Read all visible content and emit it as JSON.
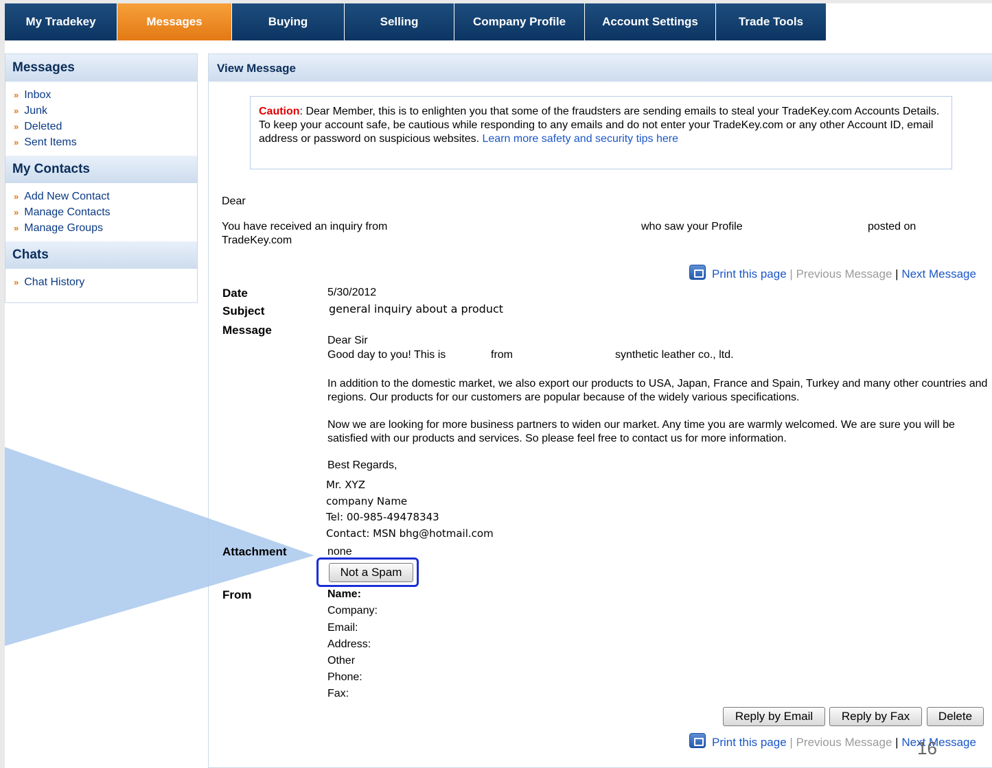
{
  "nav": {
    "tabs": [
      {
        "label": "My Tradekey",
        "active": false
      },
      {
        "label": "Messages",
        "active": true
      },
      {
        "label": "Buying",
        "active": false
      },
      {
        "label": "Selling",
        "active": false
      },
      {
        "label": "Company Profile",
        "active": false
      },
      {
        "label": "Account Settings",
        "active": false
      },
      {
        "label": "Trade Tools",
        "active": false
      }
    ]
  },
  "sidebar": {
    "messages_title": "Messages",
    "messages_items": [
      "Inbox",
      "Junk",
      "Deleted",
      "Sent Items"
    ],
    "contacts_title": "My Contacts",
    "contacts_items": [
      "Add New Contact",
      "Manage Contacts",
      "Manage Groups"
    ],
    "chats_title": "Chats",
    "chats_items": [
      "Chat History"
    ],
    "bullet": "»"
  },
  "main": {
    "title": "View Message",
    "caution": {
      "word": "Caution",
      "text": ": Dear Member, this is to enlighten you that some of the fraudsters are sending emails to steal your TradeKey.com Accounts Details. To keep your account safe, be cautious while responding to any emails and do not enter your TradeKey.com or any other Account ID, email address or password on suspicious websites. ",
      "link": "Learn more safety and security tips here"
    },
    "greeting": "Dear",
    "inquiry_text": "You have received an inquiry from",
    "saw_profile_text": "who saw your Profile",
    "posted_on_text": "posted on",
    "site_name": "TradeKey.com",
    "nav_links": {
      "print": "Print this page",
      "separator": "|",
      "previous": "Previous Message",
      "next": "Next Message"
    },
    "fields": {
      "date_label": "Date",
      "date_value": "5/30/2012",
      "subject_label": "Subject",
      "subject_value": "general inquiry about a product",
      "message_label": "Message",
      "attachment_label": "Attachment",
      "attachment_value": "none",
      "from_label": "From"
    },
    "message": {
      "salutation": "Dear Sir",
      "line1_a": "Good day to you! This is",
      "line1_b": "from",
      "line1_c": "synthetic leather co., ltd.",
      "para1": "In addition to the domestic market, we also export our products to USA, Japan, France and Spain, Turkey and many other countries and regions. Our products for our customers are popular because of the widely various specifications.",
      "para2": "Now we are looking for more business partners to widen our market. Any time you are warmly welcomed. We are sure you will be satisfied with our products and services. So please feel free to contact us for more information.",
      "closing": "Best Regards,",
      "sig_name": "Mr. XYZ",
      "sig_company": "company Name",
      "sig_tel": "Tel: 00-985-49478343",
      "sig_contact": "Contact: MSN bhg@hotmail.com"
    },
    "not_spam_button": "Not a Spam",
    "from_details": {
      "name": "Name:",
      "company": "Company:",
      "email": "Email:",
      "address": "Address:",
      "other": "Other",
      "phone": "Phone:",
      "fax": "Fax:"
    },
    "buttons": {
      "reply_email": "Reply by Email",
      "reply_fax": "Reply by Fax",
      "delete": "Delete"
    }
  },
  "slide_number": "16",
  "colors": {
    "nav_blue": "#0c3563",
    "nav_active_orange": "#e27914",
    "link_blue": "#1a56c8",
    "caution_red": "#e00000",
    "highlight_blue": "#1b2fd6",
    "callout_blue": "#a9c8ec"
  }
}
